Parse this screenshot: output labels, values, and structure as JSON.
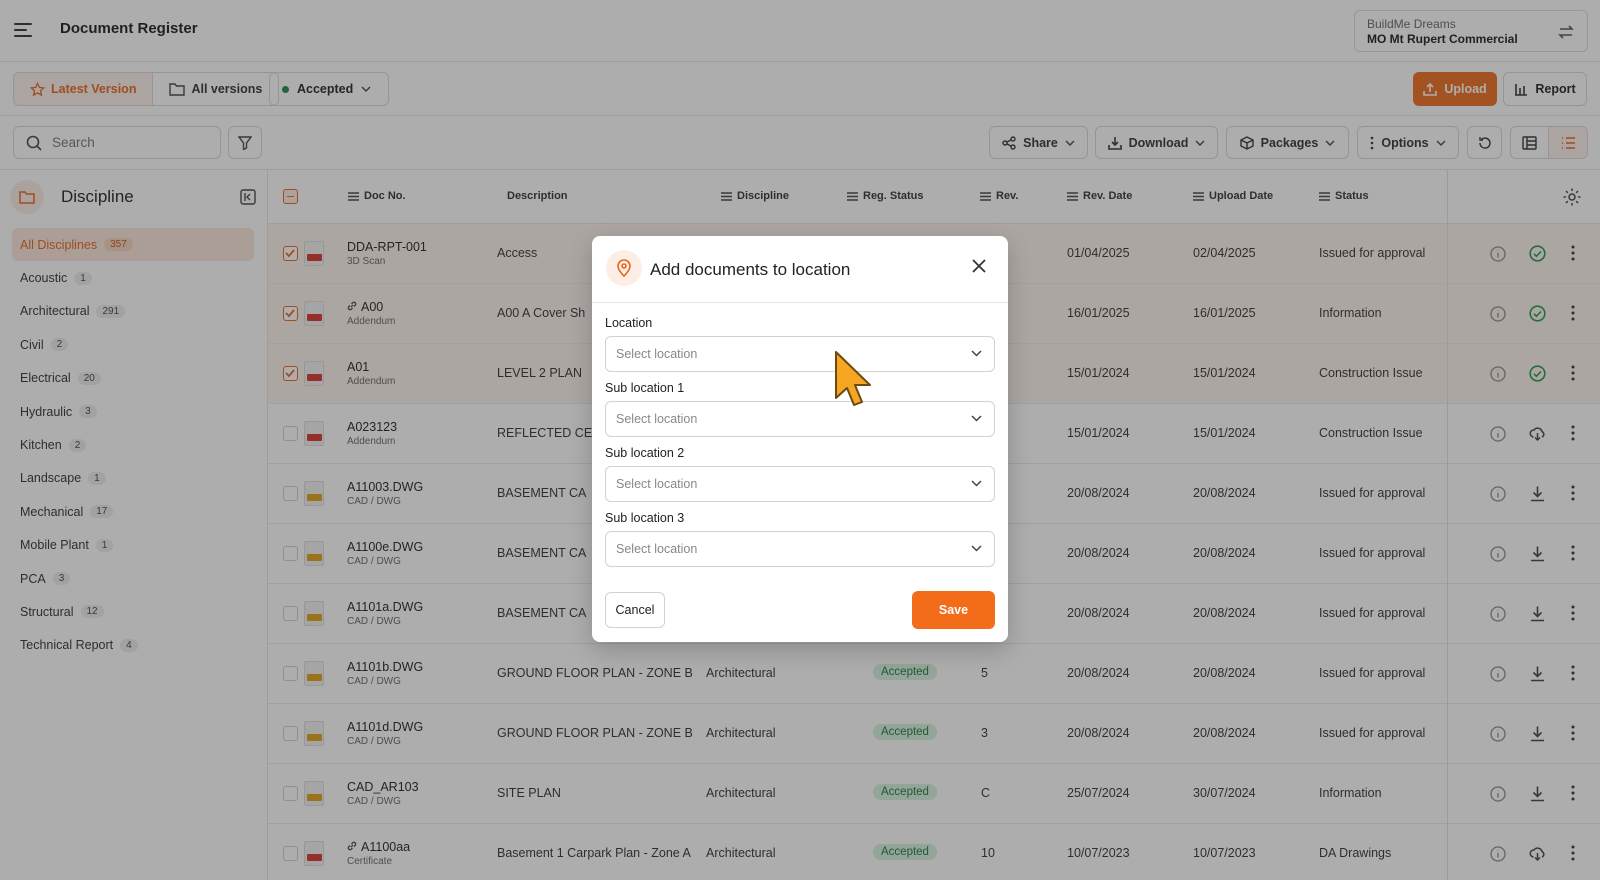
{
  "header": {
    "title": "Document Register",
    "org": "BuildMe Dreams",
    "project": "MO Mt Rupert Commercial"
  },
  "toolbar1": {
    "latest": "Latest Version",
    "all": "All versions",
    "status_filter": "Accepted",
    "upload": "Upload",
    "report": "Report"
  },
  "toolbar2": {
    "search_placeholder": "Search",
    "share": "Share",
    "download": "Download",
    "packages": "Packages",
    "options": "Options"
  },
  "sidebar": {
    "title": "Discipline",
    "items": [
      {
        "label": "All Disciplines",
        "count": "357"
      },
      {
        "label": "Acoustic",
        "count": "1"
      },
      {
        "label": "Architectural",
        "count": "291"
      },
      {
        "label": "Civil",
        "count": "2"
      },
      {
        "label": "Electrical",
        "count": "20"
      },
      {
        "label": "Hydraulic",
        "count": "3"
      },
      {
        "label": "Kitchen",
        "count": "2"
      },
      {
        "label": "Landscape",
        "count": "1"
      },
      {
        "label": "Mechanical",
        "count": "17"
      },
      {
        "label": "Mobile Plant",
        "count": "1"
      },
      {
        "label": "PCA",
        "count": "3"
      },
      {
        "label": "Structural",
        "count": "12"
      },
      {
        "label": "Technical Report",
        "count": "4"
      }
    ]
  },
  "table": {
    "columns": {
      "doc_no": "Doc No.",
      "description": "Description",
      "discipline": "Discipline",
      "reg_status": "Reg. Status",
      "rev": "Rev.",
      "rev_date": "Rev. Date",
      "upload_date": "Upload Date",
      "status": "Status"
    },
    "rows": [
      {
        "doc": "DDA-RPT-001",
        "type": "3D Scan",
        "desc": "Access",
        "disc": "",
        "reg": "",
        "rev": "",
        "rev_date": "01/04/2025",
        "upload": "02/04/2025",
        "status": "Issued for approval"
      },
      {
        "doc": "A00",
        "type": "Addendum",
        "desc": "A00 A Cover Sh",
        "disc": "",
        "reg": "",
        "rev": "",
        "rev_date": "16/01/2025",
        "upload": "16/01/2025",
        "status": "Information"
      },
      {
        "doc": "A01",
        "type": "Addendum",
        "desc": "LEVEL 2 PLAN",
        "disc": "",
        "reg": "",
        "rev": "",
        "rev_date": "15/01/2024",
        "upload": "15/01/2024",
        "status": "Construction Issue"
      },
      {
        "doc": "A023123",
        "type": "Addendum",
        "desc": "REFLECTED CE",
        "disc": "",
        "reg": "",
        "rev": "",
        "rev_date": "15/01/2024",
        "upload": "15/01/2024",
        "status": "Construction Issue"
      },
      {
        "doc": "A11003.DWG",
        "type": "CAD / DWG",
        "desc": "BASEMENT CA",
        "disc": "",
        "reg": "",
        "rev": "",
        "rev_date": "20/08/2024",
        "upload": "20/08/2024",
        "status": "Issued for approval"
      },
      {
        "doc": "A1100e.DWG",
        "type": "CAD / DWG",
        "desc": "BASEMENT CA",
        "disc": "",
        "reg": "",
        "rev": "",
        "rev_date": "20/08/2024",
        "upload": "20/08/2024",
        "status": "Issued for approval"
      },
      {
        "doc": "A1101a.DWG",
        "type": "CAD / DWG",
        "desc": "BASEMENT CA",
        "disc": "",
        "reg": "",
        "rev": "",
        "rev_date": "20/08/2024",
        "upload": "20/08/2024",
        "status": "Issued for approval"
      },
      {
        "doc": "A1101b.DWG",
        "type": "CAD / DWG",
        "desc": "GROUND FLOOR PLAN - ZONE  B",
        "disc": "Architectural",
        "reg": "Accepted",
        "rev": "5",
        "rev_date": "20/08/2024",
        "upload": "20/08/2024",
        "status": "Issued for approval"
      },
      {
        "doc": "A1101d.DWG",
        "type": "CAD / DWG",
        "desc": "GROUND FLOOR PLAN - ZONE  B",
        "disc": "Architectural",
        "reg": "Accepted",
        "rev": "3",
        "rev_date": "20/08/2024",
        "upload": "20/08/2024",
        "status": "Issued for approval"
      },
      {
        "doc": "CAD_AR103",
        "type": "CAD / DWG",
        "desc": "SITE PLAN",
        "disc": "Architectural",
        "reg": "Accepted",
        "rev": "C",
        "rev_date": "25/07/2024",
        "upload": "30/07/2024",
        "status": "Information"
      },
      {
        "doc": "A1100aa",
        "type": "Certificate",
        "desc": "Basement 1 Carpark Plan - Zone A",
        "disc": "Architectural",
        "reg": "Accepted",
        "rev": "10",
        "rev_date": "10/07/2023",
        "upload": "10/07/2023",
        "status": "DA Drawings"
      }
    ]
  },
  "modal": {
    "title": "Add documents to location",
    "location_label": "Location",
    "sub1_label": "Sub location 1",
    "sub2_label": "Sub location 2",
    "sub3_label": "Sub location 3",
    "placeholder": "Select location",
    "cancel": "Cancel",
    "save": "Save"
  },
  "colors": {
    "accent": "#ef6c1e",
    "accepted_bg": "#d5f1dd",
    "accepted_text": "#1d7a3b"
  }
}
